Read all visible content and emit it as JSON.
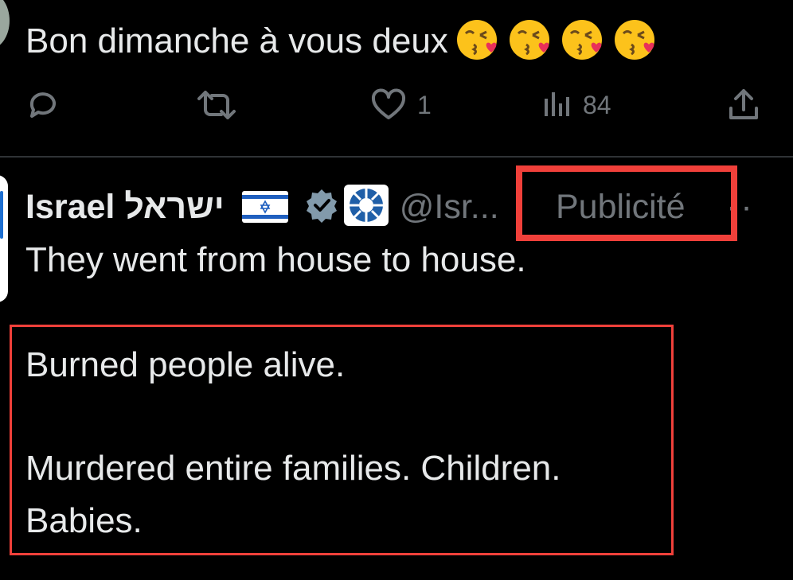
{
  "top_tweet": {
    "text": "Bon dimanche à vous deux",
    "emojis": [
      "face-blowing-a-kiss",
      "face-blowing-a-kiss",
      "face-blowing-a-kiss",
      "face-blowing-a-kiss"
    ],
    "actions": {
      "reply_count": "",
      "retweet_count": "",
      "like_count": "1",
      "view_count": "84"
    }
  },
  "promoted_tweet": {
    "author_name": "Israel ישראל",
    "handle": "@Isr...",
    "ad_label": "Publicité",
    "more": "··",
    "lines": [
      "They went from house to house.",
      "Burned people alive.",
      "Murdered entire families. Children.",
      "Babies."
    ]
  },
  "colors": {
    "background": "#000000",
    "text": "#e7e9ea",
    "muted": "#71767b",
    "divider": "#2f3336",
    "highlight": "#f0403a",
    "verified_badge": "#829aab"
  }
}
